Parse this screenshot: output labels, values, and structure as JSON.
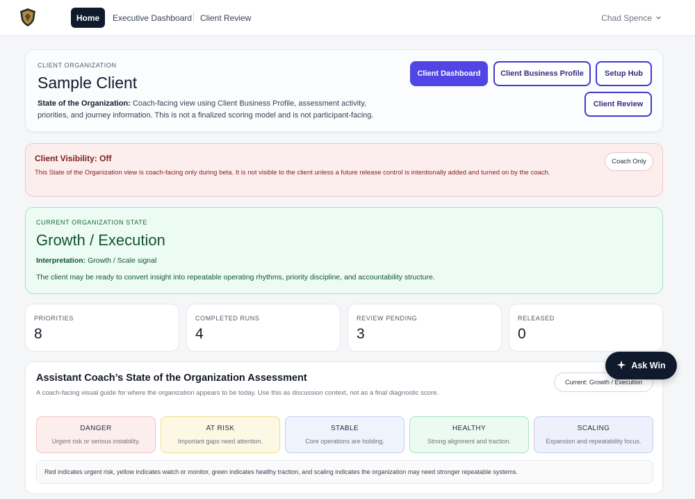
{
  "nav": {
    "home": "Home",
    "executive_dashboard": "Executive Dashboard",
    "client_review": "Client Review",
    "user_name": "Chad Spence"
  },
  "org": {
    "eyebrow": "CLIENT ORGANIZATION",
    "name": "Sample Client",
    "desc_label": "State of the Organization:",
    "desc_text": " Coach-facing view using Client Business Profile, assessment activity, priorities, and journey information. This is not a finalized scoring model and is not participant-facing.",
    "buttons": {
      "client_dashboard": "Client Dashboard",
      "client_business_profile": "Client Business Profile",
      "setup_hub": "Setup Hub",
      "client_review": "Client Review"
    }
  },
  "visibility": {
    "title": "Client Visibility: Off",
    "text": "This State of the Organization view is coach-facing only during beta. It is not visible to the client unless a future release control is intentionally added and turned on by the coach.",
    "badge": "Coach Only"
  },
  "state": {
    "eyebrow": "CURRENT ORGANIZATION STATE",
    "title": "Growth / Execution",
    "interp_label": "Interpretation:",
    "interp_value": " Growth / Scale signal",
    "desc": "The client may be ready to convert insight into repeatable operating rhythms, priority discipline, and accountability structure."
  },
  "metrics": [
    {
      "label": "PRIORITIES",
      "value": "8"
    },
    {
      "label": "COMPLETED RUNS",
      "value": "4"
    },
    {
      "label": "REVIEW PENDING",
      "value": "3"
    },
    {
      "label": "RELEASED",
      "value": "0"
    }
  ],
  "assessment": {
    "title": "Assistant Coach’s State of the Organization Assessment",
    "subtitle": "A coach-facing visual guide for where the organization appears to be today. Use this as discussion context, not as a final diagnostic score.",
    "current": "Current: Growth / Execution",
    "levels": [
      {
        "name": "DANGER",
        "desc": "Urgent risk or serious instability.",
        "bg": "#fdeeee",
        "border": "#f3c4c4"
      },
      {
        "name": "AT RISK",
        "desc": "Important gaps need attention.",
        "bg": "#fdf8e4",
        "border": "#f0dc8c"
      },
      {
        "name": "STABLE",
        "desc": "Core operations are holding.",
        "bg": "#eef3fc",
        "border": "#bdd0f0"
      },
      {
        "name": "HEALTHY",
        "desc": "Strong alignment and traction.",
        "bg": "#ebfbf1",
        "border": "#a7e3c3"
      },
      {
        "name": "SCALING",
        "desc": "Expansion and repeatability focus.",
        "bg": "#eef1fb",
        "border": "#c3cbef"
      }
    ],
    "legend": "Red indicates urgent risk, yellow indicates watch or monitor, green indicates healthy traction, and scaling indicates the organization may need stronger repeatable systems."
  },
  "ask_win": "Ask Win"
}
